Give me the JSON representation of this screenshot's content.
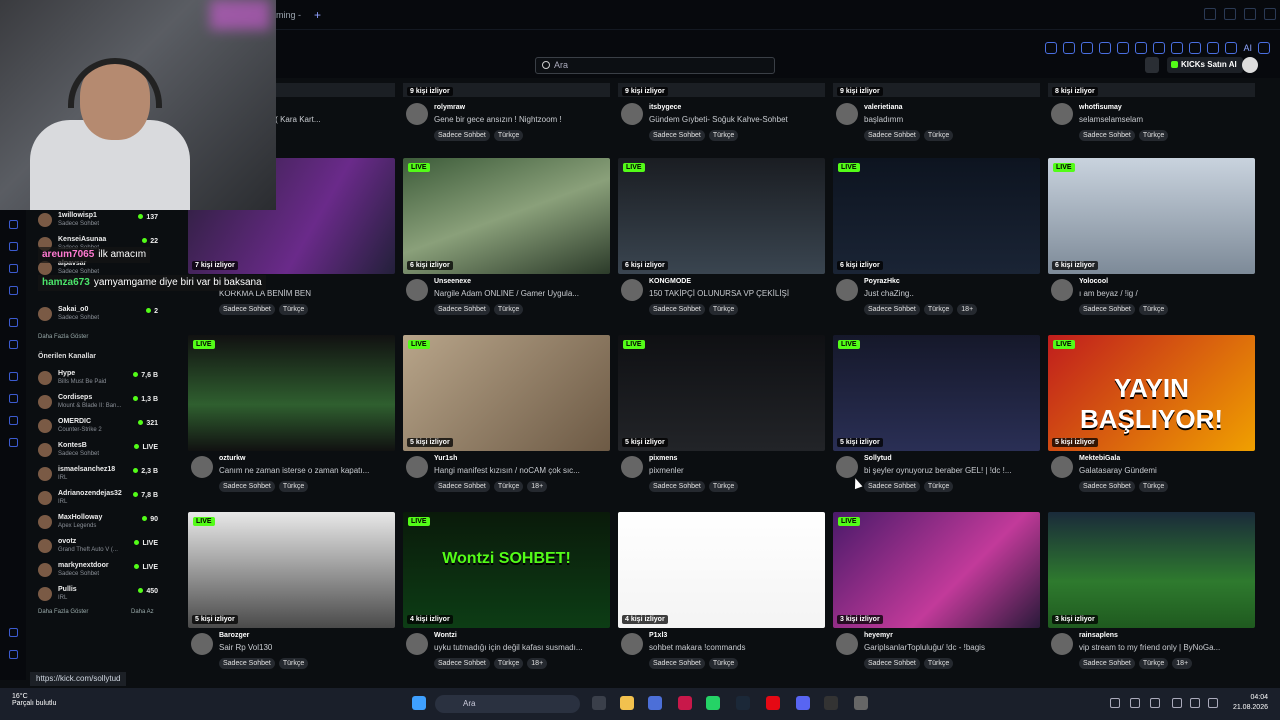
{
  "browser": {
    "tab_label": "ming - ",
    "new_tab": "+"
  },
  "toolbar": {
    "search_placeholder": "Ara",
    "kick_button": "KICKs Satın Al",
    "ai_label": "AI"
  },
  "webcam_chat": [
    {
      "user": "areum7065",
      "text": "ilk amacım"
    },
    {
      "user": "hamza673",
      "text": "yamyamgame diye biri var bi baksana"
    }
  ],
  "sidebar": {
    "following": [
      {
        "name": "1willowisp1",
        "sub": "Sadece Sohbet",
        "count": "137"
      },
      {
        "name": "KenseiAsunaa",
        "sub": "Sadece Sohbet",
        "count": "22"
      },
      {
        "name": "alpavsar",
        "sub": "Sadece Sohbet",
        "count": ""
      },
      {
        "name": "Sakai_o0",
        "sub": "Sadece Sohbet",
        "count": "2"
      }
    ],
    "show_more_1": "Daha Fazla Göster",
    "recommended_title": "Önerilen Kanallar",
    "recommended": [
      {
        "name": "Hype",
        "sub": "Bills Must Be Paid",
        "count": "7,6 B"
      },
      {
        "name": "Cordiseps",
        "sub": "Mount & Blade II: Ban...",
        "count": "1,3 B"
      },
      {
        "name": "OMERDIC",
        "sub": "Counter-Strike 2",
        "count": "321"
      },
      {
        "name": "KontesB",
        "sub": "Sadece Sohbet",
        "count": "LIVE"
      },
      {
        "name": "ismaelsanchez18",
        "sub": "IRL",
        "count": "2,3 B"
      },
      {
        "name": "Adrianozendejas32",
        "sub": "IRL",
        "count": "7,8 B"
      },
      {
        "name": "MaxHolloway",
        "sub": "Apex Legends",
        "count": "90"
      },
      {
        "name": "ovotz",
        "sub": "Grand Theft Auto V (...",
        "count": "LIVE"
      },
      {
        "name": "markynextdoor",
        "sub": "Sadece Sohbet",
        "count": "LIVE"
      },
      {
        "name": "Pullis",
        "sub": "IRL",
        "count": "450"
      }
    ],
    "show_more_2": "Daha Fazla Göster",
    "show_less": "Daha Az"
  },
  "top_row": [
    {
      "viewers": "",
      "title": "Radyo Yayını... ( Kara Kart...",
      "channel": "",
      "tags": [
        "Türkçe"
      ]
    },
    {
      "viewers": "9 kişi izliyor",
      "channel": "rolymraw",
      "title": "Gene bir gece ansızın ! Nightzoom !",
      "tags": [
        "Sadece Sohbet",
        "Türkçe"
      ]
    },
    {
      "viewers": "9 kişi izliyor",
      "channel": "itsbygece",
      "title": "Gündem Gıybeti- Soğuk Kahve-Sohbet",
      "tags": [
        "Sadece Sohbet",
        "Türkçe"
      ]
    },
    {
      "viewers": "9 kişi izliyor",
      "channel": "valerietiana",
      "title": "başladımm",
      "tags": [
        "Sadece Sohbet",
        "Türkçe"
      ]
    },
    {
      "viewers": "8 kişi izliyor",
      "channel": "whotfisumay",
      "title": "selamselamselam",
      "tags": [
        "Sadece Sohbet",
        "Türkçe"
      ]
    }
  ],
  "rows": [
    [
      {
        "live": "LIVE",
        "viewers": "7 kişi izliyor",
        "channel": "",
        "title": "KORKMA LA BENİM BEN",
        "tags": [
          "Sadece Sohbet",
          "Türkçe"
        ]
      },
      {
        "live": "LIVE",
        "viewers": "6 kişi izliyor",
        "channel": "Unseenexe",
        "title": "Nargile Adam ONLINE / Gamer Uygula...",
        "tags": [
          "Sadece Sohbet",
          "Türkçe"
        ]
      },
      {
        "live": "LIVE",
        "viewers": "6 kişi izliyor",
        "channel": "KONGMODE",
        "title": "150 TAKİPÇİ OLUNURSA VP ÇEKİLİŞİ",
        "tags": [
          "Sadece Sohbet",
          "Türkçe"
        ]
      },
      {
        "live": "LIVE",
        "viewers": "6 kişi izliyor",
        "channel": "PoyrazHkc",
        "title": "Just chaZing..",
        "tags": [
          "Sadece Sohbet",
          "Türkçe",
          "18+"
        ]
      },
      {
        "live": "LIVE",
        "viewers": "6 kişi izliyor",
        "channel": "Yolocool",
        "title": "ı am beyaz / !ig /",
        "tags": [
          "Sadece Sohbet",
          "Türkçe"
        ]
      }
    ],
    [
      {
        "live": "LIVE",
        "viewers": "",
        "channel": "ozturkw",
        "title": "Canım ne zaman isterse o zaman kapatı...",
        "tags": [
          "Sadece Sohbet",
          "Türkçe"
        ]
      },
      {
        "live": "LIVE",
        "viewers": "5 kişi izliyor",
        "channel": "Yur1sh",
        "title": "Hangi manifest kızısın / noCAM çok sıc...",
        "tags": [
          "Sadece Sohbet",
          "Türkçe",
          "18+"
        ]
      },
      {
        "live": "LIVE",
        "viewers": "5 kişi izliyor",
        "channel": "pixmens",
        "title": "pixmenler",
        "tags": [
          "Sadece Sohbet",
          "Türkçe"
        ]
      },
      {
        "live": "LIVE",
        "viewers": "5 kişi izliyor",
        "channel": "Sollytud",
        "title": "bi şeyler oynuyoruz beraber GEL! | !dc !...",
        "tags": [
          "Sadece Sohbet",
          "Türkçe"
        ]
      },
      {
        "live": "LIVE",
        "viewers": "5 kişi izliyor",
        "channel": "MektebiGala",
        "title": "Galatasaray Gündemi",
        "tags": [
          "Sadece Sohbet",
          "Türkçe"
        ],
        "banner": "YAYIN BAŞLIYOR!"
      }
    ],
    [
      {
        "live": "LIVE",
        "viewers": "5 kişi izliyor",
        "channel": "Barozger",
        "title": "Sair Rp Vol130",
        "tags": [
          "Sadece Sohbet",
          "Türkçe"
        ]
      },
      {
        "live": "LIVE",
        "viewers": "4 kişi izliyor",
        "channel": "Wontzi",
        "title": "uyku tutmadığı için değil kafası susmadı...",
        "tags": [
          "Sadece Sohbet",
          "Türkçe",
          "18+"
        ],
        "banner": "Wontzi SOHBET!"
      },
      {
        "live": "",
        "viewers": "4 kişi izliyor",
        "channel": "P1xl3",
        "title": "sohbet makara !commands",
        "tags": [
          "Sadece Sohbet",
          "Türkçe"
        ]
      },
      {
        "live": "LIVE",
        "viewers": "3 kişi izliyor",
        "channel": "heyemyr",
        "title": "GariplsanlarTopluluğu/ !dc - !bagis",
        "tags": [
          "Sadece Sohbet",
          "Türkçe"
        ]
      },
      {
        "live": "",
        "viewers": "3 kişi izliyor",
        "channel": "rainsaplens",
        "title": "vip stream to my friend only | ByNoGa...",
        "tags": [
          "Sadece Sohbet",
          "Türkçe",
          "18+"
        ]
      }
    ]
  ],
  "status_url": "https://kick.com/sollytud",
  "taskbar": {
    "weather_temp": "16°C",
    "weather_desc": "Parçalı bulutlu",
    "search": "Ara",
    "time": "04:04",
    "date": "21.08.2026"
  },
  "colors": {
    "accent": "#53fc18",
    "bg": "#0b0e11"
  }
}
